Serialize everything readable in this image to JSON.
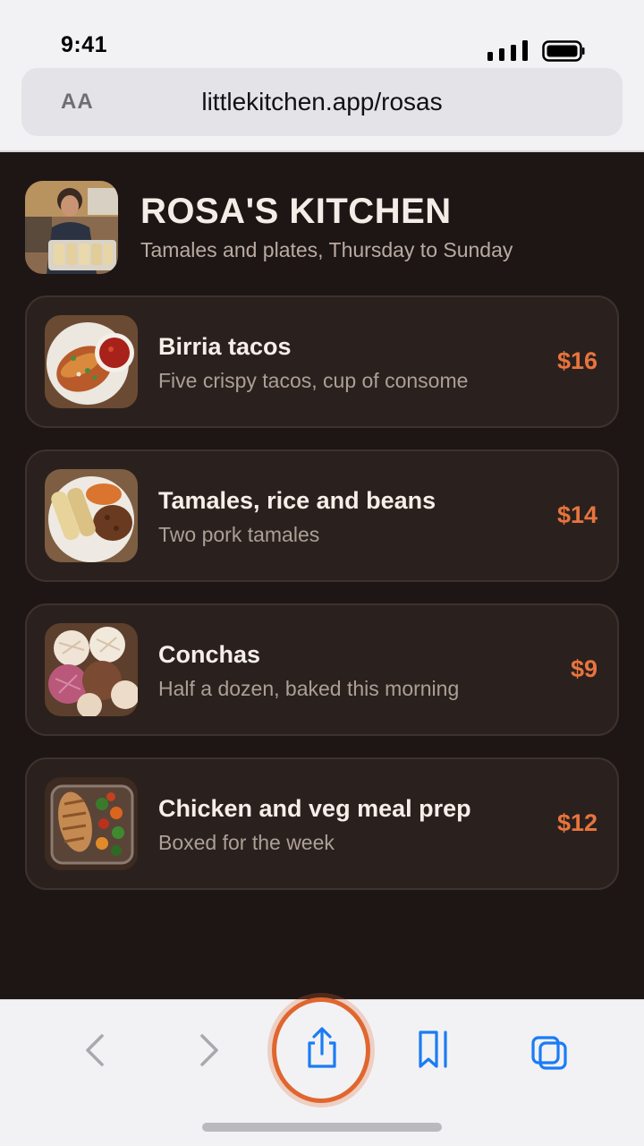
{
  "status_bar": {
    "time": "9:41"
  },
  "browser": {
    "aa_label": "AA",
    "url": "littlekitchen.app/rosas"
  },
  "shop": {
    "title": "ROSA'S KITCHEN",
    "subtitle": "Tamales and plates, Thursday to Sunday"
  },
  "menu": [
    {
      "name": "Birria tacos",
      "description": "Five crispy tacos, cup of consome",
      "price": "$16",
      "photo": "birria-tacos-photo"
    },
    {
      "name": "Tamales, rice and beans",
      "description": "Two pork tamales",
      "price": "$14",
      "photo": "tamales-plate-photo"
    },
    {
      "name": "Conchas",
      "description": "Half a dozen, baked this morning",
      "price": "$9",
      "photo": "conchas-photo"
    },
    {
      "name": "Chicken and veg meal prep",
      "description": "Boxed for the week",
      "price": "$12",
      "photo": "meal-prep-photo"
    }
  ],
  "toolbar": {
    "icons": [
      "back-icon",
      "forward-icon",
      "share-icon",
      "bookmarks-icon",
      "tabs-icon"
    ],
    "highlighted": "share-icon"
  },
  "colors": {
    "page_background": "#1d1614",
    "card_background": "#2a211e",
    "price": "#e8743d",
    "highlight_ring": "#e0662f",
    "toolbar_accent": "#1a7cf5",
    "toolbar_disabled": "#a8a8ad"
  }
}
